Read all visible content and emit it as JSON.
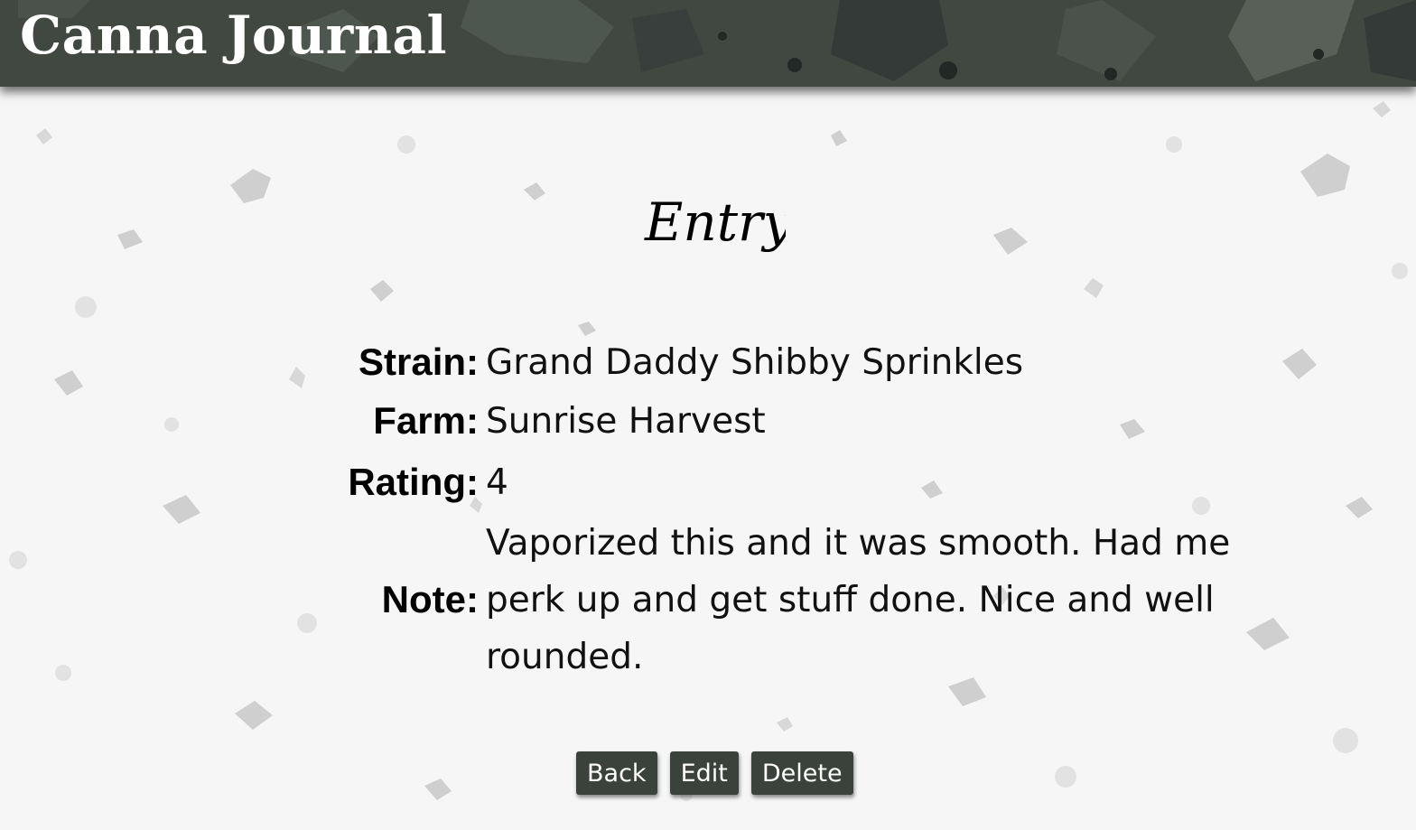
{
  "header": {
    "title": "Canna Journal"
  },
  "entry": {
    "heading": "Entry",
    "fields": {
      "strain": {
        "label": "Strain:",
        "value": "Grand Daddy Shibby Sprinkles"
      },
      "farm": {
        "label": "Farm:",
        "value": "Sunrise Harvest"
      },
      "rating": {
        "label": "Rating:",
        "value": "4"
      },
      "note": {
        "label": "Note:",
        "value": "Vaporized this and it was smooth. Had me perk up and get stuff done. Nice and well rounded."
      }
    }
  },
  "actions": {
    "back_label": "Back",
    "edit_label": "Edit",
    "delete_label": "Delete"
  },
  "colors": {
    "header_bg": "#404841",
    "button_bg": "#3a423b",
    "page_bg": "#f6f6f6",
    "speckle": "#c8c8c8"
  }
}
